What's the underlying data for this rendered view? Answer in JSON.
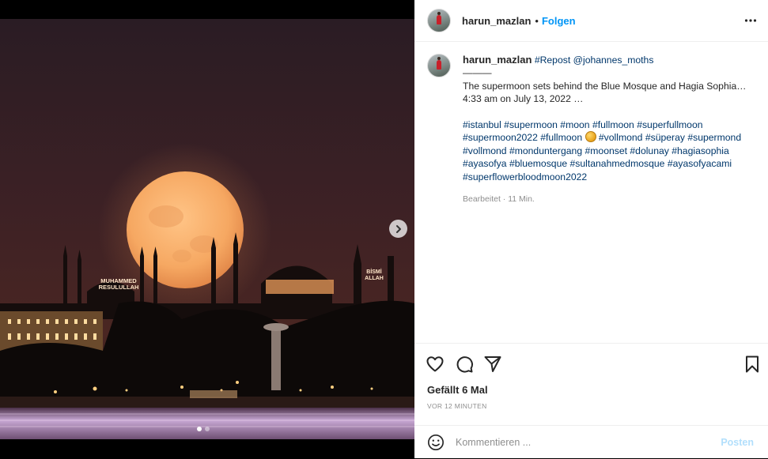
{
  "post": {
    "username": "harun_mazlan",
    "separator": "•",
    "follow_label": "Folgen"
  },
  "caption": {
    "username": "harun_mazlan",
    "repost_tag": "#Repost",
    "mention": "@johannes_moths",
    "divider": "———",
    "text_line1": "The supermoon sets behind the Blue Mosque and Hagia Sophia…",
    "text_line2": "4:33 am on July 13, 2022 …",
    "hashtags_a": "#istanbul #supermoon #moon #fullmoon #superfullmoon #supermoon2022 #fullmoon",
    "hashtags_b": "#vollmond #süperay #supermond #vollmond #monduntergang #moonset #dolunay #hagiasophia #ayasofya #bluemosque #sultanahmedmosque #ayasofyacami #superflowerbloodmoon2022",
    "edited": "Bearbeitet · 11 Min."
  },
  "image": {
    "sign_line1": "MUHAMMED",
    "sign_line2": "RESULULLAH",
    "sign_right1": "BİSMİ",
    "sign_right2": "ALLAH"
  },
  "engagement": {
    "likes": "Gefällt 6 Mal",
    "time": "VOR 12 MINUTEN"
  },
  "comment": {
    "placeholder": "Kommentieren ...",
    "post_label": "Posten"
  },
  "icons": {
    "more": "more-horizontal-icon",
    "like": "heart-icon",
    "comment": "comment-bubble-icon",
    "share": "paper-plane-icon",
    "save": "bookmark-icon",
    "emoji": "smiley-icon",
    "next": "chevron-right-icon"
  },
  "colors": {
    "link_blue": "#0095f6",
    "hashtag": "#00376b",
    "post_disabled": "#b2dffc",
    "moon": "#f0a866"
  }
}
